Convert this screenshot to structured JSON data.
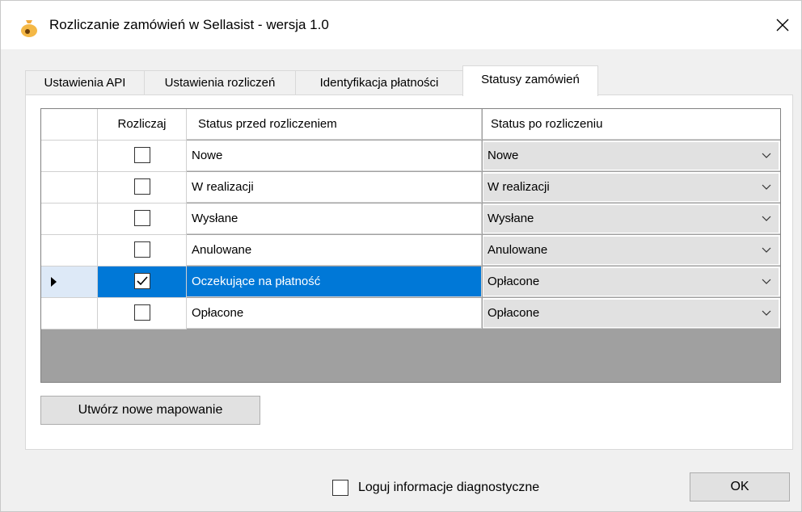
{
  "window": {
    "title": "Rozliczanie zamówień w Sellasist - wersja 1.0",
    "icon": "money-bag-icon",
    "accent_color": "#0078d7"
  },
  "tabs": [
    {
      "label": "Ustawienia API",
      "active": false
    },
    {
      "label": "Ustawienia rozliczeń",
      "active": false
    },
    {
      "label": "Identyfikacja płatności",
      "active": false
    },
    {
      "label": "Statusy zamówień",
      "active": true
    }
  ],
  "grid": {
    "columns": [
      "",
      "Rozliczaj",
      "Status przed rozliczeniem",
      "Status po rozliczeniu"
    ],
    "rows": [
      {
        "checked": false,
        "before": "Nowe",
        "after": "Nowe",
        "selected": false
      },
      {
        "checked": false,
        "before": "W realizacji",
        "after": "W realizacji",
        "selected": false
      },
      {
        "checked": false,
        "before": "Wysłane",
        "after": "Wysłane",
        "selected": false
      },
      {
        "checked": false,
        "before": "Anulowane",
        "after": "Anulowane",
        "selected": false
      },
      {
        "checked": true,
        "before": "Oczekujące na płatność",
        "after": "Opłacone",
        "selected": true
      },
      {
        "checked": false,
        "before": "Opłacone",
        "after": "Opłacone",
        "selected": false
      }
    ]
  },
  "buttons": {
    "new_mapping": "Utwórz nowe mapowanie",
    "ok": "OK"
  },
  "diagnostics": {
    "label": "Loguj informacje diagnostyczne",
    "checked": false
  }
}
